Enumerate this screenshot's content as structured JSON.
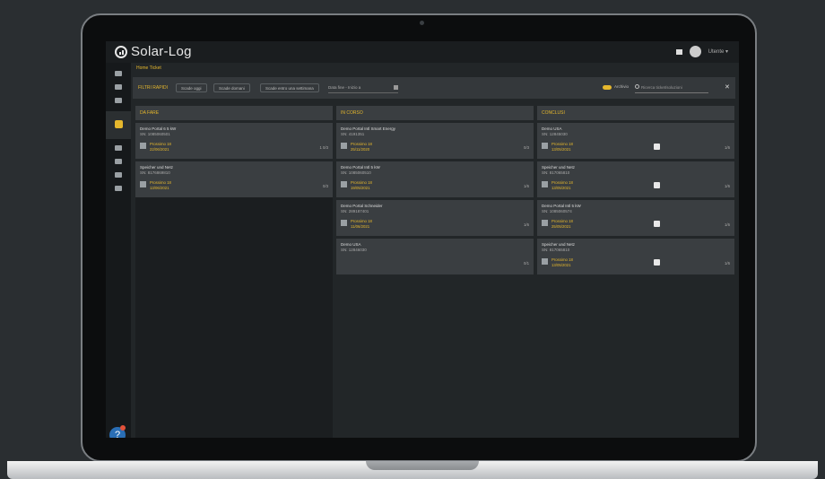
{
  "app": {
    "logo_text": "Solar-Log",
    "user_label": "Utente ▾"
  },
  "breadcrumb": "Home Ticket",
  "filters": {
    "label": "FILTRI RAPIDI",
    "chips": [
      "Scade oggi",
      "Scade domani",
      "Scade entro una settimana"
    ],
    "date_select": "Data fine - Inizio a",
    "archive_label": "Archivio",
    "search_placeholder": "Ricerca ticket/soluzioni",
    "close_symbol": "✕"
  },
  "columns": [
    {
      "title": "DA FARE",
      "cards": [
        {
          "title": "Demo Portal 6 5 kW",
          "sn": "SN: 1085060501",
          "status": "Prossimo 18",
          "date": "22/06/2021",
          "count": "1 0/3",
          "check": false
        },
        {
          "title": "Speicher und Netz",
          "sn": "SN: 8176869810",
          "status": "Prossimo 18",
          "date": "13/06/2021",
          "count": "0/3",
          "check": false
        }
      ]
    },
    {
      "title": "IN CORSO",
      "cards": [
        {
          "title": "Demo Portal Intl Smart Energy",
          "sn": "SN: 4191351",
          "status": "Prossimo 18",
          "date": "25/11/2020",
          "count": "0/3",
          "check": false
        },
        {
          "title": "Demo Portal Intl 5 kW",
          "sn": "SN: 1085060510",
          "status": "Prossimo 18",
          "date": "19/05/2021",
          "count": "1/6",
          "check": false
        },
        {
          "title": "Demo Portal Schneider",
          "sn": "SN: 289187401",
          "status": "Prossimo 18",
          "date": "11/06/2021",
          "count": "1/6",
          "check": false
        },
        {
          "title": "Demo USA",
          "sn": "SN: 12846030",
          "status": "",
          "date": "",
          "count": "0/1",
          "check": false
        }
      ]
    },
    {
      "title": "CONCLUSI",
      "cards": [
        {
          "title": "Demo USA",
          "sn": "SN: 12845030",
          "status": "Prossimo 18",
          "date": "13/05/2021",
          "count": "1/6",
          "check": true
        },
        {
          "title": "Speicher und Netz",
          "sn": "SN: 817065810",
          "status": "Prossimo 18",
          "date": "13/05/2021",
          "count": "1/6",
          "check": true
        },
        {
          "title": "Demo Portal Intl 5 kW",
          "sn": "SN: 1085060574",
          "status": "Prossimo 18",
          "date": "25/05/2021",
          "count": "1/6",
          "check": true
        },
        {
          "title": "Speicher und Netz",
          "sn": "SN: 817065810",
          "status": "Prossimo 18",
          "date": "13/05/2021",
          "count": "1/6",
          "check": true
        }
      ]
    }
  ],
  "help_symbol": "?"
}
